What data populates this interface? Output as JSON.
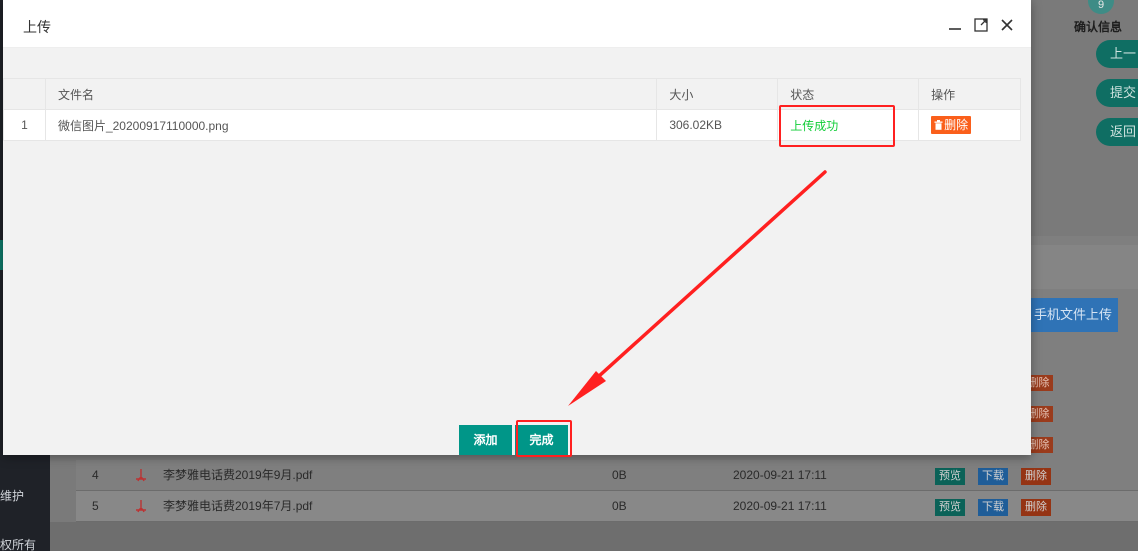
{
  "modal": {
    "title": "上传",
    "table": {
      "headers": [
        "",
        "文件名",
        "大小",
        "状态",
        "操作"
      ],
      "rows": [
        {
          "index": "1",
          "filename": "微信图片_20200917110000.png",
          "size": "306.02KB",
          "status": "上传成功",
          "action": "删除"
        }
      ]
    },
    "buttons": {
      "add": "添加",
      "done": "完成"
    }
  },
  "background": {
    "step_number": "9",
    "step_label": "确认信息",
    "side_buttons": [
      "上一",
      "提交",
      "返回"
    ],
    "phone_upload": "手机文件上传",
    "sidebar_items": [
      "维护",
      "权所有"
    ],
    "rows": [
      {
        "index": "4",
        "name": "李梦雅电话费2019年9月.pdf",
        "size": "0B",
        "time": "2020-09-21 17:11",
        "preview": "预览",
        "download": "下载",
        "delete": "删除"
      },
      {
        "index": "5",
        "name": "李梦雅电话费2019年7月.pdf",
        "size": "0B",
        "time": "2020-09-21 17:11",
        "preview": "预览",
        "download": "下载",
        "delete": "删除"
      }
    ],
    "partial_delete": "删除"
  },
  "colors": {
    "success": "#13ce3a",
    "danger": "#fa5f1b",
    "primary": "#009688",
    "annotation": "#ff2020"
  }
}
